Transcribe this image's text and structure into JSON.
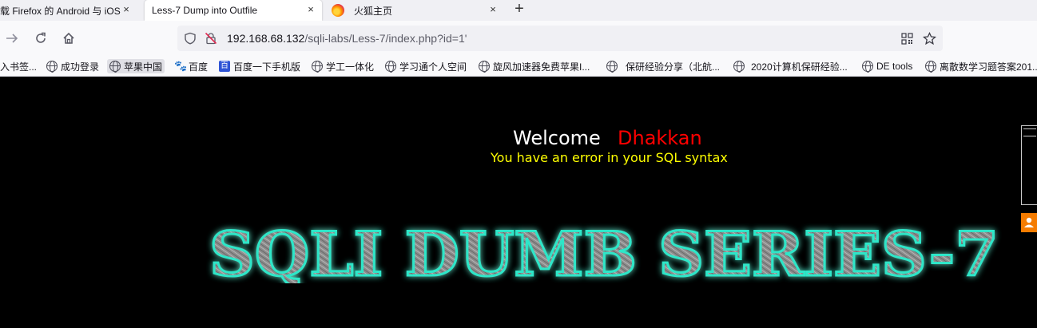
{
  "tabs": [
    {
      "label": "载 Firefox 的 Android 与 iOS",
      "close": "×"
    },
    {
      "label": "Less-7 Dump into Outfile",
      "close": "×"
    },
    {
      "label": "火狐主页",
      "close": "×"
    }
  ],
  "new_tab": "+",
  "nav": {
    "url_host": "192.168.68.132",
    "url_path": "/sqli-labs/Less-7/index.php?id=1'"
  },
  "bookmarks": [
    {
      "label": "入书签...",
      "icon": "none"
    },
    {
      "label": "成功登录",
      "icon": "globe-icon"
    },
    {
      "label": "苹果中国",
      "icon": "globe-icon"
    },
    {
      "label": "百度",
      "icon": "baidu-paw-icon"
    },
    {
      "label": "百度一下手机版",
      "icon": "baidu-box-icon"
    },
    {
      "label": "学工一体化",
      "icon": "globe-icon"
    },
    {
      "label": "学习通个人空间",
      "icon": "globe-icon"
    },
    {
      "label": "旋风加速器免费苹果I...",
      "icon": "globe-icon"
    },
    {
      "label": "保研经验分享（北航...",
      "icon": "globe-icon"
    },
    {
      "label": "2020计算机保研经验...",
      "icon": "globe-icon"
    },
    {
      "label": "DE tools",
      "icon": "globe-icon"
    },
    {
      "label": "离散数学习题答案201...",
      "icon": "globe-icon"
    }
  ],
  "page": {
    "welcome": "Welcome",
    "name": "Dhakkan",
    "error": "You have an error in your SQL syntax",
    "banner": "SQLI DUMB SERIES-7"
  },
  "colors": {
    "background": "#000000",
    "welcome": "#ffffff",
    "name": "#ff0000",
    "error": "#ffff00",
    "banner_glow": "#2ee6c8"
  }
}
